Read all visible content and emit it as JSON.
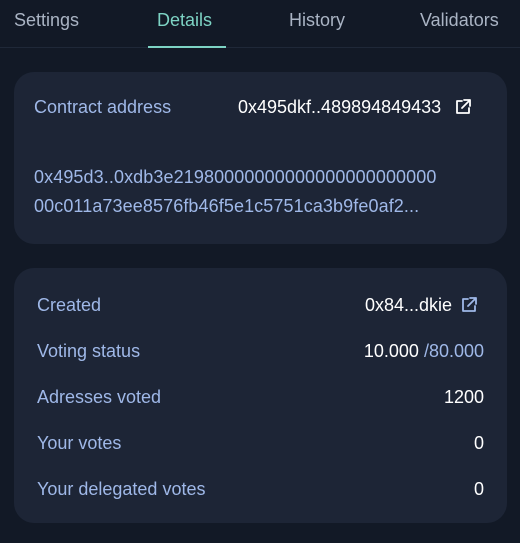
{
  "tabs": [
    {
      "label": "Settings"
    },
    {
      "label": "Details"
    },
    {
      "label": "History"
    },
    {
      "label": "Validators"
    }
  ],
  "active_tab": "Details",
  "contract": {
    "label": "Contract address",
    "short_address": "0x495dkf..489894849433",
    "data_line1": "0x495d3..0xdb3e21980000000000000000000000",
    "data_line2": "00c011a73ee8576fb46f5e1c5751ca3b9fe0af2..."
  },
  "details": {
    "created_label": "Created",
    "created_value": "0x84...dkie",
    "voting_status_label": "Voting status",
    "voting_current": "10.000",
    "voting_total": "/80.000",
    "addresses_voted_label": "Adresses voted",
    "addresses_voted_value": "1200",
    "your_votes_label": "Your votes",
    "your_votes_value": "0",
    "delegated_votes_label": "Your delegated votes",
    "delegated_votes_value": "0"
  },
  "colors": {
    "background": "#121926",
    "card": "#1d2536",
    "accent_teal": "#7dd3c4",
    "label_blue": "#9fb8e8"
  },
  "icons": {
    "external_link": "external-link-icon"
  }
}
